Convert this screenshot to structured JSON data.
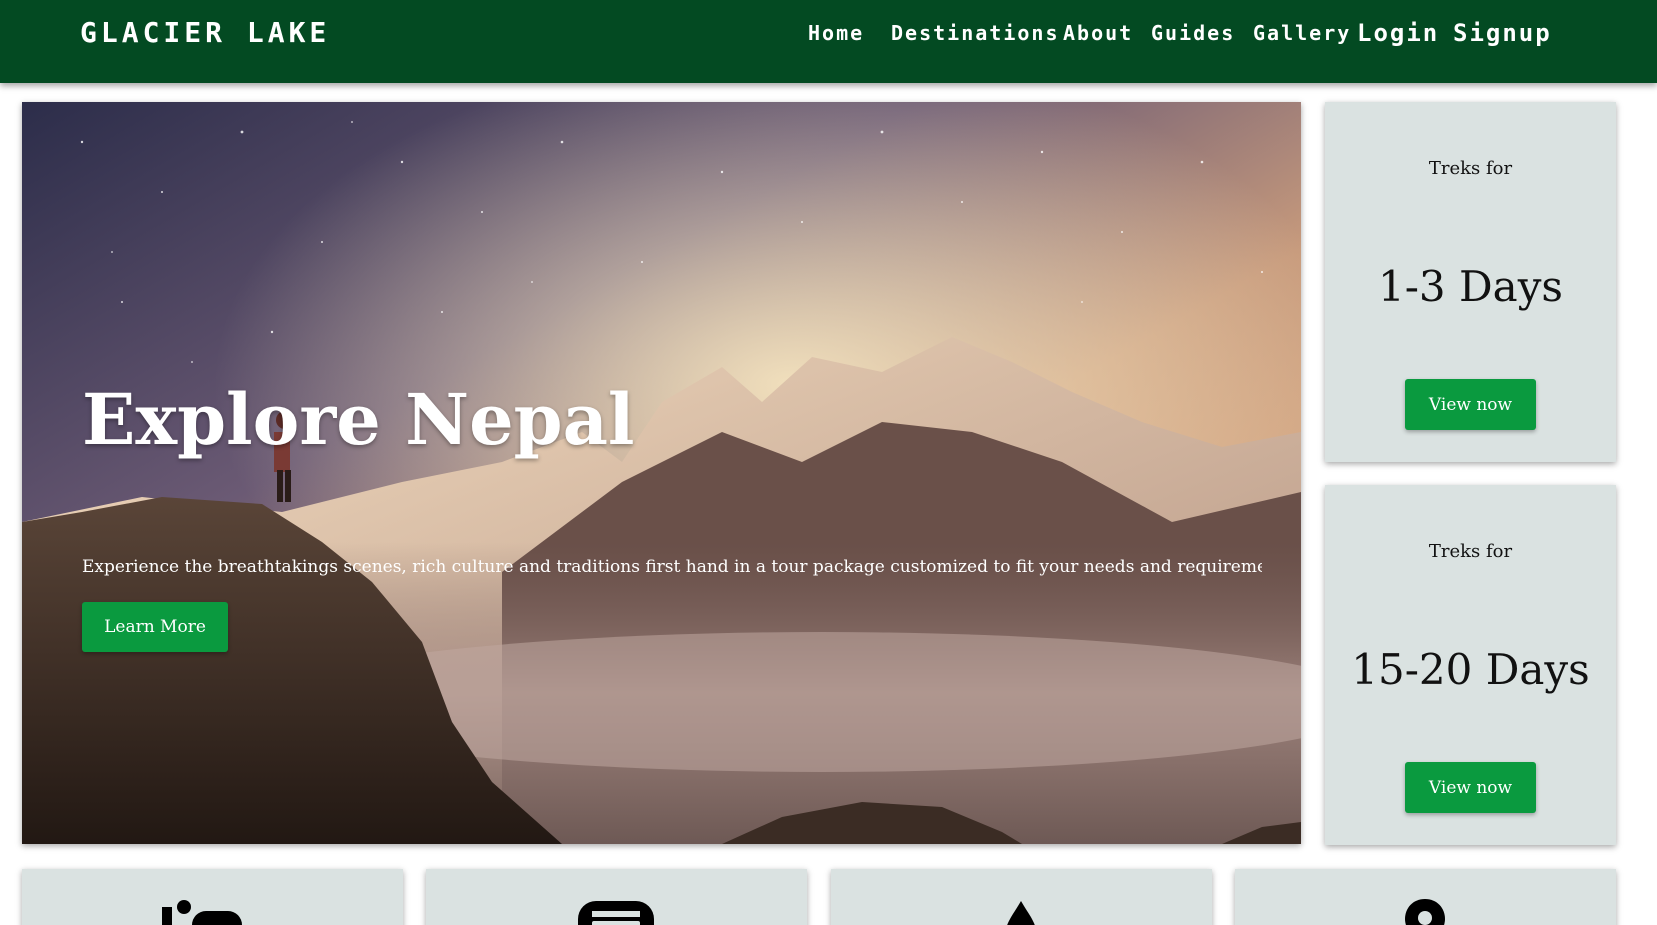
{
  "brand": "GLACIER LAKE",
  "nav": {
    "home": "Home",
    "destinations": "Destinations",
    "about": "About",
    "guides": "Guides",
    "gallery": "Gallery",
    "login": "Login",
    "signup": "Signup"
  },
  "hero": {
    "title": "Explore Nepal",
    "description": "Experience the breathtakings scenes, rich culture and traditions first hand in a tour package customized to fit your needs and requirements.",
    "button": "Learn More"
  },
  "treks": [
    {
      "label": "Treks for",
      "days": "1-3 Days",
      "button": "View now"
    },
    {
      "label": "Treks for",
      "days": "15-20 Days",
      "button": "View now"
    }
  ],
  "features": [
    {
      "icon": "hiker-icon"
    },
    {
      "icon": "bus-icon"
    },
    {
      "icon": "drop-icon"
    },
    {
      "icon": "map-pin-icon"
    }
  ],
  "colors": {
    "navbar": "#034a22",
    "button": "#0a9a3f",
    "card": "#dae2e1"
  }
}
